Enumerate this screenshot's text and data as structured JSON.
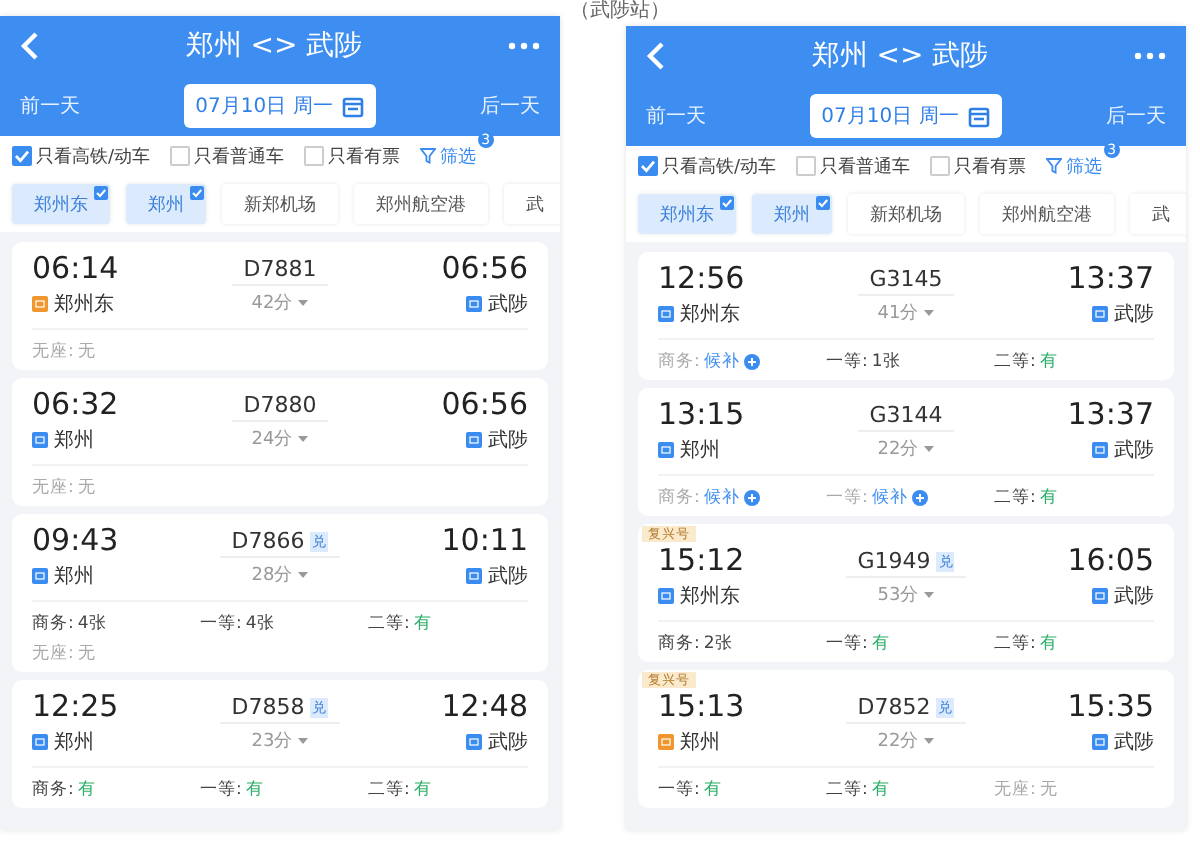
{
  "caption": "（武陟站）",
  "screens": [
    {
      "title": "郑州 <> 武陟",
      "prev_day": "前一天",
      "date": "07月10日 周一",
      "next_day": "后一天",
      "filters": [
        {
          "label": "只看高铁/动车",
          "checked": true
        },
        {
          "label": "只看普通车",
          "checked": false
        },
        {
          "label": "只看有票",
          "checked": false
        }
      ],
      "filter_button": "筛选",
      "filter_count": "3",
      "stations": [
        {
          "label": "郑州东",
          "selected": true
        },
        {
          "label": "郑州",
          "selected": true
        },
        {
          "label": "新郑机场",
          "selected": false
        },
        {
          "label": "郑州航空港",
          "selected": false
        },
        {
          "label": "武",
          "selected": false
        }
      ],
      "trains": [
        {
          "depart": "06:14",
          "train_no": "D7881",
          "duration": "42分",
          "arrive": "06:56",
          "from": {
            "name": "郑州东",
            "kind": "origin"
          },
          "to": {
            "name": "武陟",
            "kind": "pass"
          },
          "seats": [
            {
              "label": "无座:",
              "value": "无",
              "kind": "none"
            }
          ]
        },
        {
          "depart": "06:32",
          "train_no": "D7880",
          "duration": "24分",
          "arrive": "06:56",
          "from": {
            "name": "郑州",
            "kind": "pass"
          },
          "to": {
            "name": "武陟",
            "kind": "pass"
          },
          "seats": [
            {
              "label": "无座:",
              "value": "无",
              "kind": "none"
            }
          ]
        },
        {
          "depart": "09:43",
          "train_no": "D7866",
          "badge": "兑",
          "duration": "28分",
          "arrive": "10:11",
          "from": {
            "name": "郑州",
            "kind": "pass"
          },
          "to": {
            "name": "武陟",
            "kind": "pass"
          },
          "seats": [
            {
              "label": "商务:",
              "value": "4张",
              "kind": "count"
            },
            {
              "label": "一等:",
              "value": "4张",
              "kind": "count"
            },
            {
              "label": "二等:",
              "value": "有",
              "kind": "plenty"
            },
            {
              "label": "无座:",
              "value": "无",
              "kind": "none"
            }
          ]
        },
        {
          "depart": "12:25",
          "train_no": "D7858",
          "badge": "兑",
          "duration": "23分",
          "arrive": "12:48",
          "from": {
            "name": "郑州",
            "kind": "pass"
          },
          "to": {
            "name": "武陟",
            "kind": "pass"
          },
          "seats": [
            {
              "label": "商务:",
              "value": "有",
              "kind": "plenty"
            },
            {
              "label": "一等:",
              "value": "有",
              "kind": "plenty"
            },
            {
              "label": "二等:",
              "value": "有",
              "kind": "plenty"
            }
          ]
        }
      ]
    },
    {
      "title": "郑州 <> 武陟",
      "prev_day": "前一天",
      "date": "07月10日 周一",
      "next_day": "后一天",
      "filters": [
        {
          "label": "只看高铁/动车",
          "checked": true
        },
        {
          "label": "只看普通车",
          "checked": false
        },
        {
          "label": "只看有票",
          "checked": false
        }
      ],
      "filter_button": "筛选",
      "filter_count": "3",
      "stations": [
        {
          "label": "郑州东",
          "selected": true
        },
        {
          "label": "郑州",
          "selected": true
        },
        {
          "label": "新郑机场",
          "selected": false
        },
        {
          "label": "郑州航空港",
          "selected": false
        },
        {
          "label": "武",
          "selected": false
        }
      ],
      "trains": [
        {
          "depart": "12:56",
          "train_no": "G3145",
          "duration": "41分",
          "arrive": "13:37",
          "from": {
            "name": "郑州东",
            "kind": "pass"
          },
          "to": {
            "name": "武陟",
            "kind": "pass"
          },
          "seats": [
            {
              "label": "商务:",
              "value": "候补",
              "kind": "waitlist"
            },
            {
              "label": "一等:",
              "value": "1张",
              "kind": "count"
            },
            {
              "label": "二等:",
              "value": "有",
              "kind": "plenty"
            }
          ]
        },
        {
          "depart": "13:15",
          "train_no": "G3144",
          "duration": "22分",
          "arrive": "13:37",
          "from": {
            "name": "郑州",
            "kind": "pass"
          },
          "to": {
            "name": "武陟",
            "kind": "pass"
          },
          "seats": [
            {
              "label": "商务:",
              "value": "候补",
              "kind": "waitlist"
            },
            {
              "label": "一等:",
              "value": "候补",
              "kind": "waitlist"
            },
            {
              "label": "二等:",
              "value": "有",
              "kind": "plenty"
            }
          ]
        },
        {
          "tag": "复兴号",
          "depart": "15:12",
          "train_no": "G1949",
          "badge": "兑",
          "duration": "53分",
          "arrive": "16:05",
          "from": {
            "name": "郑州东",
            "kind": "pass"
          },
          "to": {
            "name": "武陟",
            "kind": "pass"
          },
          "seats": [
            {
              "label": "商务:",
              "value": "2张",
              "kind": "count"
            },
            {
              "label": "一等:",
              "value": "有",
              "kind": "plenty"
            },
            {
              "label": "二等:",
              "value": "有",
              "kind": "plenty"
            }
          ]
        },
        {
          "tag": "复兴号",
          "depart": "15:13",
          "train_no": "D7852",
          "badge": "兑",
          "duration": "22分",
          "arrive": "15:35",
          "from": {
            "name": "郑州",
            "kind": "origin"
          },
          "to": {
            "name": "武陟",
            "kind": "pass"
          },
          "seats": [
            {
              "label": "一等:",
              "value": "有",
              "kind": "plenty"
            },
            {
              "label": "二等:",
              "value": "有",
              "kind": "plenty"
            },
            {
              "label": "无座:",
              "value": "无",
              "kind": "none"
            }
          ]
        }
      ]
    }
  ]
}
